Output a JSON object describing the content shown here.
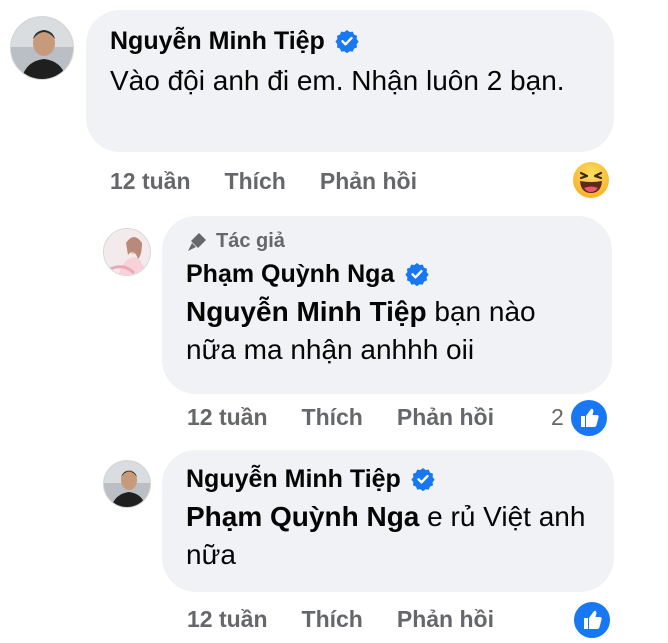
{
  "comment1": {
    "author": "Nguyễn Minh Tiệp",
    "text": "Vào đội anh đi em. Nhận luôn 2 bạn.",
    "time": "12 tuần",
    "like_label": "Thích",
    "reply_label": "Phản hồi",
    "reaction": "haha"
  },
  "reply1": {
    "author_tag": "Tác giả",
    "author": "Phạm Quỳnh Nga",
    "mention": "Nguyễn Minh Tiệp",
    "text": " bạn nào nữa ma nhận anhhh oii",
    "time": "12 tuần",
    "like_label": "Thích",
    "reply_label": "Phản hồi",
    "reaction_count": "2",
    "reaction": "like"
  },
  "reply2": {
    "author": "Nguyễn Minh Tiệp",
    "mention": "Phạm Quỳnh Nga",
    "text": " e rủ Việt anh nữa",
    "time": "12 tuần",
    "like_label": "Thích",
    "reply_label": "Phản hồi",
    "reaction": "like"
  },
  "colors": {
    "bubble": "#f0f2f5",
    "verified": "#1877f2",
    "muted": "#65676b",
    "like": "#1877f2"
  }
}
